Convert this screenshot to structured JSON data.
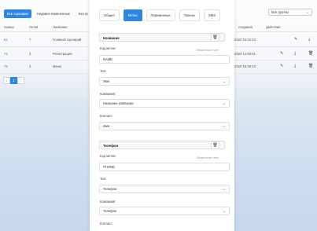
{
  "bg": {
    "tabs": [
      {
        "label": "Все сценарии",
        "active": true
      },
      {
        "label": "Недавно измененные",
        "active": false
      },
      {
        "label": "Без гр",
        "active": false
      }
    ],
    "group_select": "Все группы",
    "columns": {
      "number": "Номер",
      "steps": "Узлов",
      "name": "Название",
      "created": "создания",
      "actions": "Действия"
    },
    "rows": [
      {
        "number": "62",
        "steps": "7",
        "name": "Главный сценарий",
        "created": "2020 15:02:23"
      },
      {
        "number": "74",
        "steps": "3",
        "name": "Регистрация",
        "created": "2020 14:59:01"
      },
      {
        "number": "78",
        "steps": "3",
        "name": "Меню",
        "created": "2020 15:39:33"
      }
    ],
    "pager": [
      "‹",
      "1",
      "›"
    ]
  },
  "modal": {
    "tabs": [
      {
        "label": "Общее",
        "active": false
      },
      {
        "label": "Метки",
        "active": true
      },
      {
        "label": "Переменные",
        "active": false
      },
      {
        "label": "Токены",
        "active": false
      },
      {
        "label": "SMS",
        "active": false
      }
    ],
    "sections": [
      {
        "title": "Название",
        "code_label": "Код метки:",
        "code_hint": "Обязательное поле",
        "code_value": "NAME",
        "type_label": "Тип:",
        "type_value": "Имя",
        "company_label": "Компания:",
        "company_value": "Название компании",
        "contact_label": "Контакт:",
        "contact_value": "Имя"
      },
      {
        "title": "Телефон",
        "code_label": "Код метки:",
        "code_hint": "Обязательное поле",
        "code_value": "PHONE",
        "type_label": "Тип:",
        "type_value": "Телефон",
        "company_label": "Компания:",
        "company_value": "Телефон",
        "contact_label": "Контакт:"
      }
    ]
  },
  "icons": {
    "edit": "edit-icon",
    "download": "download-icon",
    "trash": "trash-icon",
    "chevron": "chevron-down-icon"
  },
  "colors": {
    "accent": "#2f86e1"
  }
}
